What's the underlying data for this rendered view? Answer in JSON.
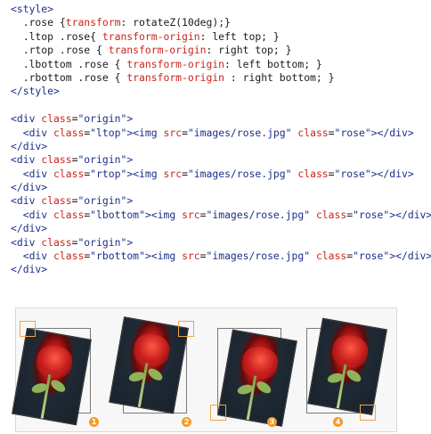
{
  "code": {
    "lines": [
      [
        {
          "t": "<style>",
          "c": "tag"
        }
      ],
      [
        {
          "t": "  .rose {",
          "c": "plain"
        },
        {
          "t": "transform",
          "c": "prop"
        },
        {
          "t": ": rotateZ(10deg);}",
          "c": "plain"
        }
      ],
      [
        {
          "t": "  .ltop .rose{ ",
          "c": "plain"
        },
        {
          "t": "transform-origin",
          "c": "prop"
        },
        {
          "t": ": left top; }",
          "c": "plain"
        }
      ],
      [
        {
          "t": "  .rtop .rose { ",
          "c": "plain"
        },
        {
          "t": "transform-origin",
          "c": "prop"
        },
        {
          "t": ": right top; }",
          "c": "plain"
        }
      ],
      [
        {
          "t": "  .lbottom .rose { ",
          "c": "plain"
        },
        {
          "t": "transform-origin",
          "c": "prop"
        },
        {
          "t": ": left bottom; }",
          "c": "plain"
        }
      ],
      [
        {
          "t": "  .rbottom .rose { ",
          "c": "plain"
        },
        {
          "t": "transform-origin",
          "c": "prop"
        },
        {
          "t": " : right bottom; }",
          "c": "plain"
        }
      ],
      [
        {
          "t": "</style>",
          "c": "tag"
        }
      ],
      [
        {
          "t": "",
          "c": "plain"
        }
      ],
      [
        {
          "t": "<div ",
          "c": "tag"
        },
        {
          "t": "class",
          "c": "attr"
        },
        {
          "t": "=",
          "c": "plain"
        },
        {
          "t": "\"origin\"",
          "c": "val"
        },
        {
          "t": ">",
          "c": "tag"
        }
      ],
      [
        {
          "t": "  <div ",
          "c": "tag"
        },
        {
          "t": "class",
          "c": "attr"
        },
        {
          "t": "=",
          "c": "plain"
        },
        {
          "t": "\"ltop\"",
          "c": "val"
        },
        {
          "t": "><img ",
          "c": "tag"
        },
        {
          "t": "src",
          "c": "attr"
        },
        {
          "t": "=",
          "c": "plain"
        },
        {
          "t": "\"images/rose.jpg\"",
          "c": "val"
        },
        {
          "t": " ",
          "c": "plain"
        },
        {
          "t": "class",
          "c": "attr"
        },
        {
          "t": "=",
          "c": "plain"
        },
        {
          "t": "\"rose\"",
          "c": "val"
        },
        {
          "t": "></div>",
          "c": "tag"
        }
      ],
      [
        {
          "t": "</div>",
          "c": "tag"
        }
      ],
      [
        {
          "t": "<div ",
          "c": "tag"
        },
        {
          "t": "class",
          "c": "attr"
        },
        {
          "t": "=",
          "c": "plain"
        },
        {
          "t": "\"origin\"",
          "c": "val"
        },
        {
          "t": ">",
          "c": "tag"
        }
      ],
      [
        {
          "t": "  <div ",
          "c": "tag"
        },
        {
          "t": "class",
          "c": "attr"
        },
        {
          "t": "=",
          "c": "plain"
        },
        {
          "t": "\"rtop\"",
          "c": "val"
        },
        {
          "t": "><img ",
          "c": "tag"
        },
        {
          "t": "src",
          "c": "attr"
        },
        {
          "t": "=",
          "c": "plain"
        },
        {
          "t": "\"images/rose.jpg\"",
          "c": "val"
        },
        {
          "t": " ",
          "c": "plain"
        },
        {
          "t": "class",
          "c": "attr"
        },
        {
          "t": "=",
          "c": "plain"
        },
        {
          "t": "\"rose\"",
          "c": "val"
        },
        {
          "t": "></div>",
          "c": "tag"
        }
      ],
      [
        {
          "t": "</div>",
          "c": "tag"
        }
      ],
      [
        {
          "t": "<div ",
          "c": "tag"
        },
        {
          "t": "class",
          "c": "attr"
        },
        {
          "t": "=",
          "c": "plain"
        },
        {
          "t": "\"origin\"",
          "c": "val"
        },
        {
          "t": ">",
          "c": "tag"
        }
      ],
      [
        {
          "t": "  <div ",
          "c": "tag"
        },
        {
          "t": "class",
          "c": "attr"
        },
        {
          "t": "=",
          "c": "plain"
        },
        {
          "t": "\"lbottom\"",
          "c": "val"
        },
        {
          "t": "><img ",
          "c": "tag"
        },
        {
          "t": "src",
          "c": "attr"
        },
        {
          "t": "=",
          "c": "plain"
        },
        {
          "t": "\"images/rose.jpg\"",
          "c": "val"
        },
        {
          "t": " ",
          "c": "plain"
        },
        {
          "t": "class",
          "c": "attr"
        },
        {
          "t": "=",
          "c": "plain"
        },
        {
          "t": "\"rose\"",
          "c": "val"
        },
        {
          "t": "></div>",
          "c": "tag"
        }
      ],
      [
        {
          "t": "</div>",
          "c": "tag"
        }
      ],
      [
        {
          "t": "<div ",
          "c": "tag"
        },
        {
          "t": "class",
          "c": "attr"
        },
        {
          "t": "=",
          "c": "plain"
        },
        {
          "t": "\"origin\"",
          "c": "val"
        },
        {
          "t": ">",
          "c": "tag"
        }
      ],
      [
        {
          "t": "  <div ",
          "c": "tag"
        },
        {
          "t": "class",
          "c": "attr"
        },
        {
          "t": "=",
          "c": "plain"
        },
        {
          "t": "\"rbottom\"",
          "c": "val"
        },
        {
          "t": "><img ",
          "c": "tag"
        },
        {
          "t": "src",
          "c": "attr"
        },
        {
          "t": "=",
          "c": "plain"
        },
        {
          "t": "\"images/rose.jpg\"",
          "c": "val"
        },
        {
          "t": " ",
          "c": "plain"
        },
        {
          "t": "class",
          "c": "attr"
        },
        {
          "t": "=",
          "c": "plain"
        },
        {
          "t": "\"rose\"",
          "c": "val"
        },
        {
          "t": "></div>",
          "c": "tag"
        }
      ],
      [
        {
          "t": "</div>",
          "c": "tag"
        }
      ]
    ]
  },
  "demo": {
    "items": [
      {
        "origin": "left top",
        "number": "1"
      },
      {
        "origin": "right top",
        "number": "2"
      },
      {
        "origin": "left bottom",
        "number": "3"
      },
      {
        "origin": "right bottom",
        "number": "4"
      }
    ],
    "colors": {
      "marker": "#f0a64a",
      "badge": "#f29a2e",
      "tag": "#1b2f8a",
      "attr": "#c8261d"
    }
  }
}
